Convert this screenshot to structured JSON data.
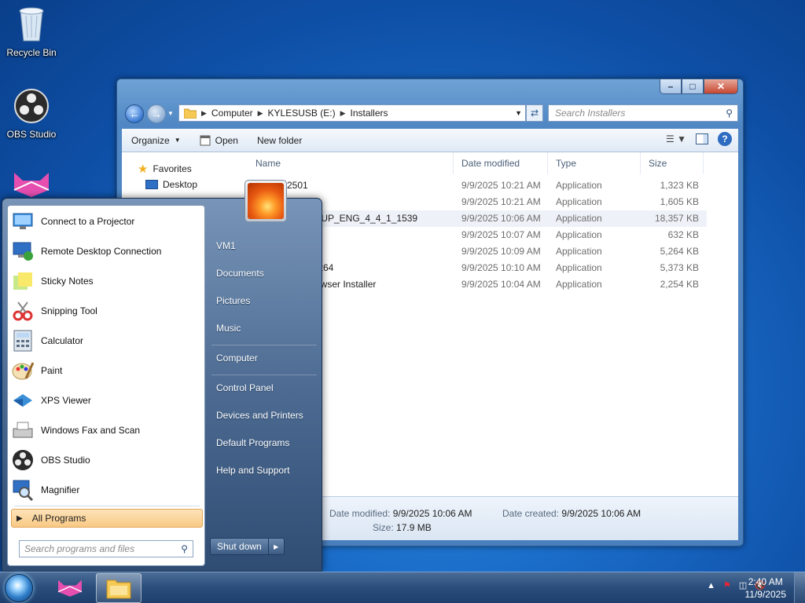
{
  "desktop": {
    "icons": [
      {
        "label": "Recycle Bin",
        "icon": "recycle-bin-icon"
      },
      {
        "label": "OBS Studio",
        "icon": "obs-studio-icon"
      },
      {
        "label": "",
        "icon": "app-cat-icon"
      }
    ]
  },
  "explorer": {
    "caption_buttons": {
      "minimize": "–",
      "maximize": "□",
      "close": "✕"
    },
    "breadcrumbs": [
      "Computer",
      "KYLESUSB (E:)",
      "Installers"
    ],
    "search_placeholder": "Search Installers",
    "toolbar": {
      "organize": "Organize",
      "open": "Open",
      "new_folder": "New folder"
    },
    "nav": {
      "favorites": "Favorites",
      "desktop": "Desktop"
    },
    "columns": {
      "name": "Name",
      "date": "Date modified",
      "type": "Type",
      "size": "Size"
    },
    "files": [
      {
        "name": "2501",
        "date": "9/9/2025 10:21 AM",
        "type": "Application",
        "size": "1,323 KB"
      },
      {
        "name": "",
        "date": "9/9/2025 10:21 AM",
        "type": "Application",
        "size": "1,605 KB"
      },
      {
        "name": "TUP_ENG_4_4_1_1539",
        "date": "9/9/2025 10:06 AM",
        "type": "Application",
        "size": "18,357 KB"
      },
      {
        "name": "",
        "date": "9/9/2025 10:07 AM",
        "type": "Application",
        "size": "632 KB"
      },
      {
        "name": "",
        "date": "9/9/2025 10:09 AM",
        "type": "Application",
        "size": "5,264 KB"
      },
      {
        "name": "-x64",
        "date": "9/9/2025 10:10 AM",
        "type": "Application",
        "size": "5,373 KB"
      },
      {
        "name": "owser Installer",
        "date": "9/9/2025 10:04 AM",
        "type": "Application",
        "size": "2,254 KB"
      }
    ],
    "details": {
      "modified_label": "Date modified:",
      "modified": "9/9/2025 10:06 AM",
      "created_label": "Date created:",
      "created": "9/9/2025 10:06 AM",
      "size_label": "Size:",
      "size": "17.9 MB"
    }
  },
  "start_menu": {
    "programs": [
      {
        "label": "Connect to a Projector",
        "icon": "projector-icon"
      },
      {
        "label": "Remote Desktop Connection",
        "icon": "remote-desktop-icon"
      },
      {
        "label": "Sticky Notes",
        "icon": "sticky-notes-icon"
      },
      {
        "label": "Snipping Tool",
        "icon": "snipping-tool-icon"
      },
      {
        "label": "Calculator",
        "icon": "calculator-icon"
      },
      {
        "label": "Paint",
        "icon": "paint-icon"
      },
      {
        "label": "XPS Viewer",
        "icon": "xps-viewer-icon"
      },
      {
        "label": "Windows Fax and Scan",
        "icon": "fax-scan-icon"
      },
      {
        "label": "OBS Studio",
        "icon": "obs-studio-icon"
      },
      {
        "label": "Magnifier",
        "icon": "magnifier-icon"
      }
    ],
    "all_programs": "All Programs",
    "search_placeholder": "Search programs and files",
    "places": [
      "VM1",
      "Documents",
      "Pictures",
      "Music",
      "Computer",
      "Control Panel",
      "Devices and Printers",
      "Default Programs",
      "Help and Support"
    ],
    "shutdown": "Shut down"
  },
  "taskbar": {
    "time": "2:40 AM",
    "date": "11/9/2025"
  }
}
